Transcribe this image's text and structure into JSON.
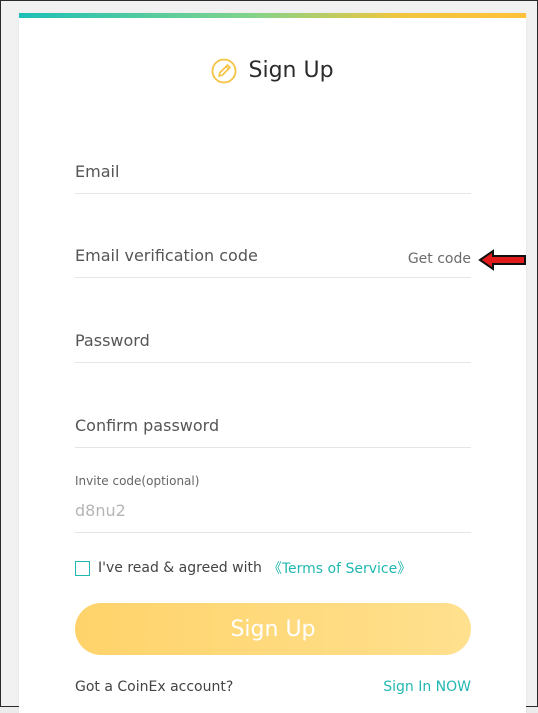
{
  "header": {
    "title": "Sign Up",
    "title_icon": "pencil-icon",
    "accent_gradient": [
      "#1cc0b7",
      "#ffc23a"
    ]
  },
  "form": {
    "email_placeholder": "Email",
    "code_placeholder": "Email verification code",
    "get_code_label": "Get code",
    "password_placeholder": "Password",
    "confirm_placeholder": "Confirm password",
    "invite_label": "Invite code(optional)",
    "invite_value": "d8nu2",
    "agree_text": "I've read & agreed with",
    "terms_label": "《Terms of Service》",
    "agree_checked": false,
    "submit_label": "Sign Up"
  },
  "footer": {
    "prompt": "Got a CoinEx account?",
    "signin_label": "Sign In NOW"
  },
  "colors": {
    "teal_accent": "#22b8b2",
    "button_yellow": "#ffd36a",
    "annotation_arrow": "#e21c1c"
  }
}
